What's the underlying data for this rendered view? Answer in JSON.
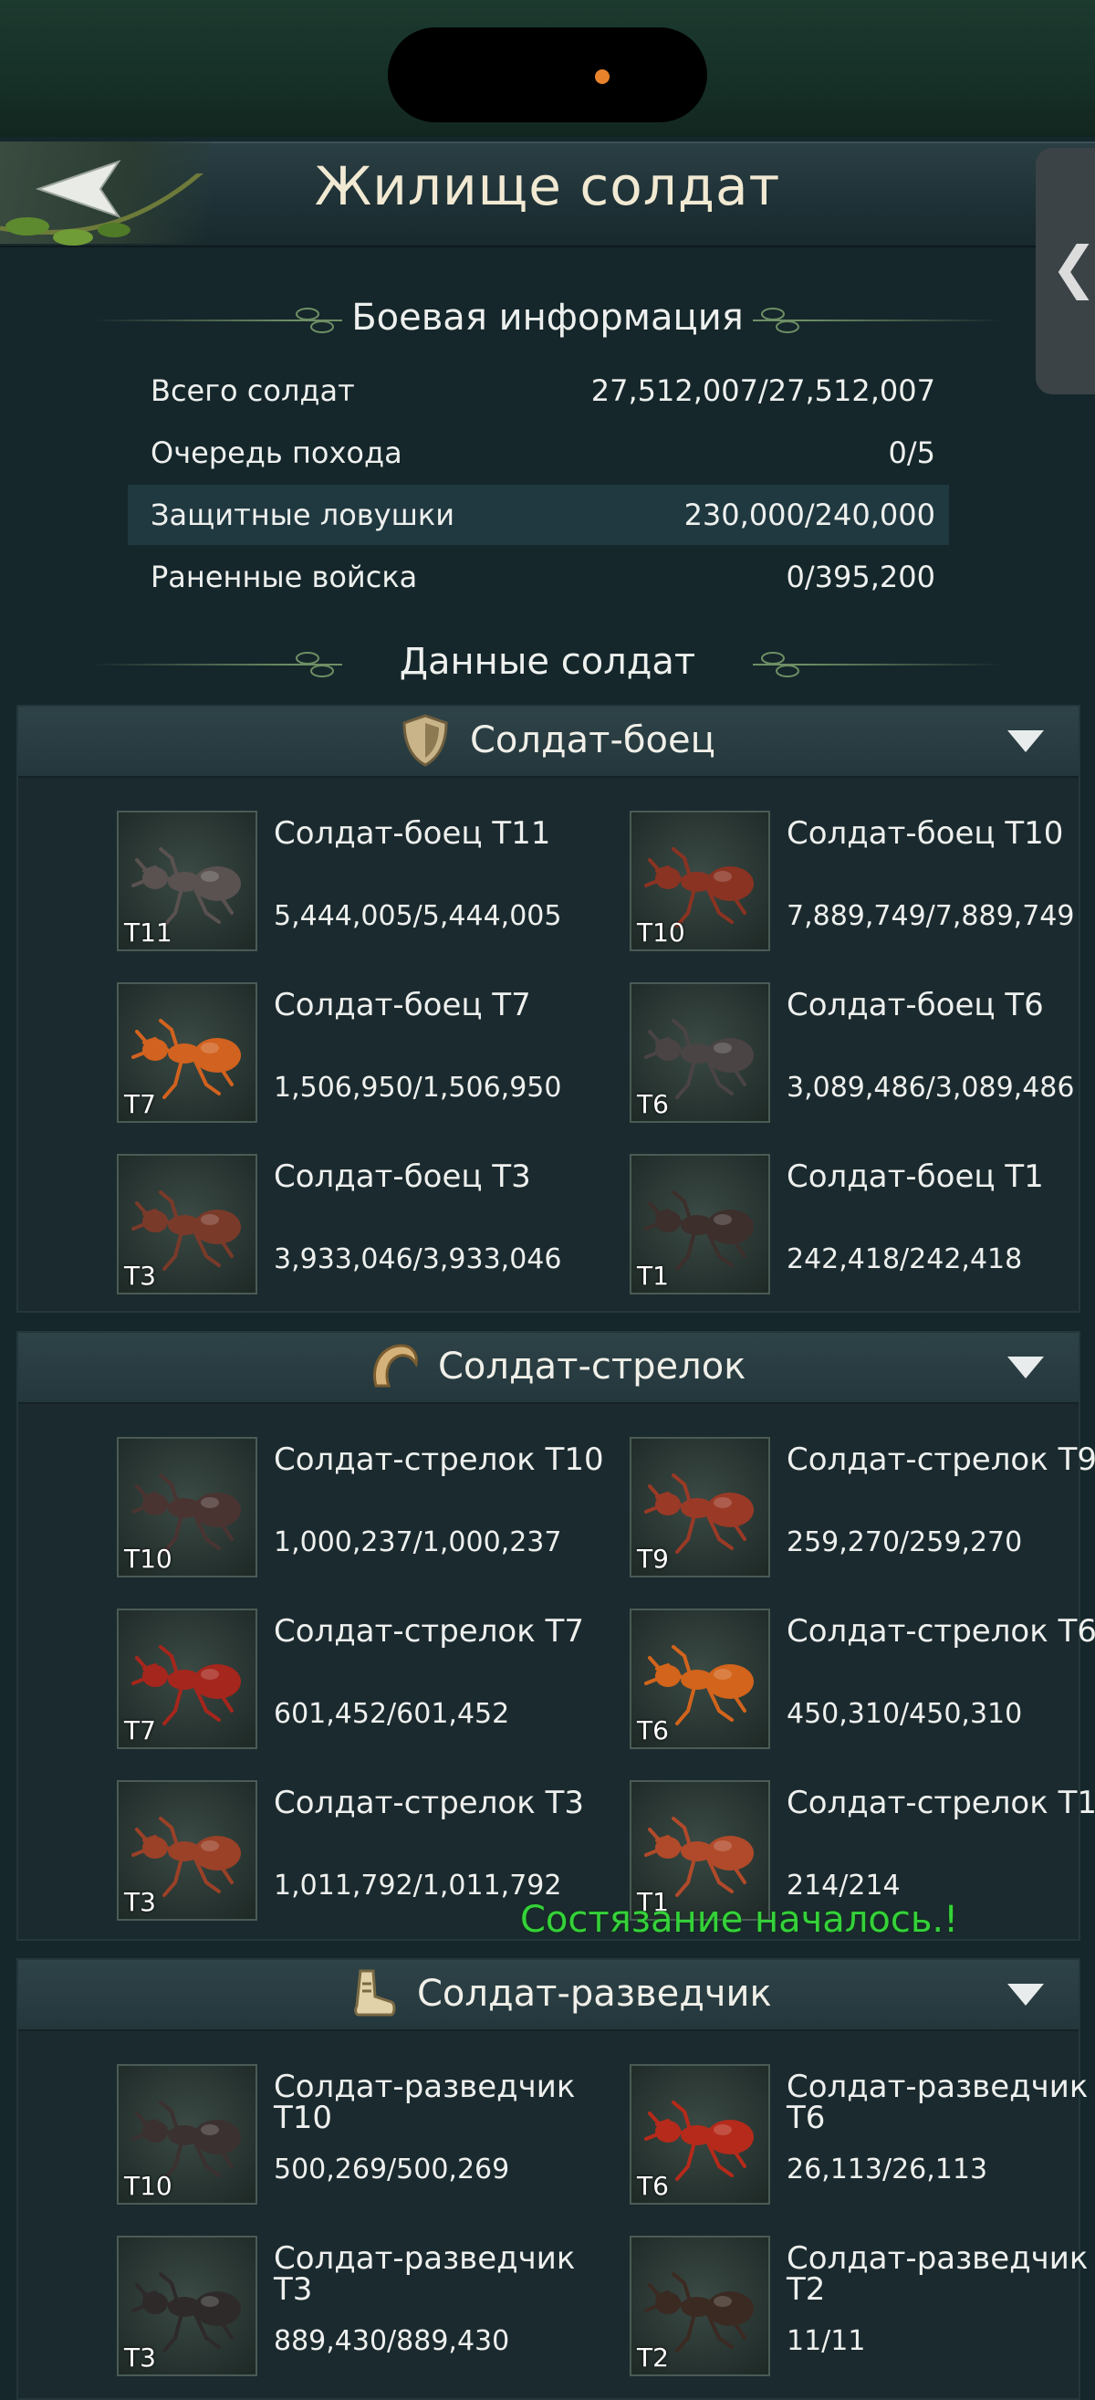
{
  "title": "Жилище солдат",
  "battle_info": {
    "heading": "Боевая информация",
    "rows": [
      {
        "label": "Всего солдат",
        "value": "27,512,007/27,512,007"
      },
      {
        "label": "Очередь похода",
        "value": "0/5"
      },
      {
        "label": "Защитные ловушки",
        "value": "230,000/240,000"
      },
      {
        "label": "Раненные войска",
        "value": "0/395,200"
      }
    ]
  },
  "soldier_data_heading": "Данные солдат",
  "categories": [
    {
      "label": "Солдат-боец",
      "icon": "shield-icon",
      "units": [
        {
          "name": "Солдат-боец Т11",
          "tier": "T11",
          "count": "5,444,005/5,444,005",
          "color": "#5a5250"
        },
        {
          "name": "Солдат-боец Т10",
          "tier": "T10",
          "count": "7,889,749/7,889,749",
          "color": "#8a3322"
        },
        {
          "name": "Солдат-боец Т7",
          "tier": "T7",
          "count": "1,506,950/1,506,950",
          "color": "#d2621f"
        },
        {
          "name": "Солдат-боец Т6",
          "tier": "T6",
          "count": "3,089,486/3,089,486",
          "color": "#4a4444"
        },
        {
          "name": "Солдат-боец Т3",
          "tier": "T3",
          "count": "3,933,046/3,933,046",
          "color": "#7a3a2a"
        },
        {
          "name": "Солдат-боец Т1",
          "tier": "T1",
          "count": "242,418/242,418",
          "color": "#3d2f2c"
        }
      ]
    },
    {
      "label": "Солдат-стрелок",
      "icon": "horn-icon",
      "units": [
        {
          "name": "Солдат-стрелок Т10",
          "tier": "T10",
          "count": "1,000,237/1,000,237",
          "color": "#4a3432"
        },
        {
          "name": "Солдат-стрелок Т9",
          "tier": "T9",
          "count": "259,270/259,270",
          "color": "#9a3a26"
        },
        {
          "name": "Солдат-стрелок Т7",
          "tier": "T7",
          "count": "601,452/601,452",
          "color": "#a5261c"
        },
        {
          "name": "Солдат-стрелок Т6",
          "tier": "T6",
          "count": "450,310/450,310",
          "color": "#d2641c"
        },
        {
          "name": "Солдат-стрелок Т3",
          "tier": "T3",
          "count": "1,011,792/1,011,792",
          "color": "#9a4128"
        },
        {
          "name": "Солдат-стрелок Т1",
          "tier": "T1",
          "count": "214/214",
          "color": "#b14a2a"
        }
      ]
    },
    {
      "label": "Солдат-разведчик",
      "icon": "boot-icon",
      "units": [
        {
          "name": "Солдат-разведчик Т10",
          "tier": "T10",
          "count": "500,269/500,269",
          "color": "#3b3130"
        },
        {
          "name": "Солдат-разведчик Т6",
          "tier": "T6",
          "count": "26,113/26,113",
          "color": "#b52a1a"
        },
        {
          "name": "Солдат-разведчик Т3",
          "tier": "T3",
          "count": "889,430/889,430",
          "color": "#2e2a2a"
        },
        {
          "name": "Солдат-разведчик Т2",
          "tier": "T2",
          "count": "11/11",
          "color": "#3a2a22"
        }
      ]
    }
  ],
  "toast": "Состязание началось.!"
}
